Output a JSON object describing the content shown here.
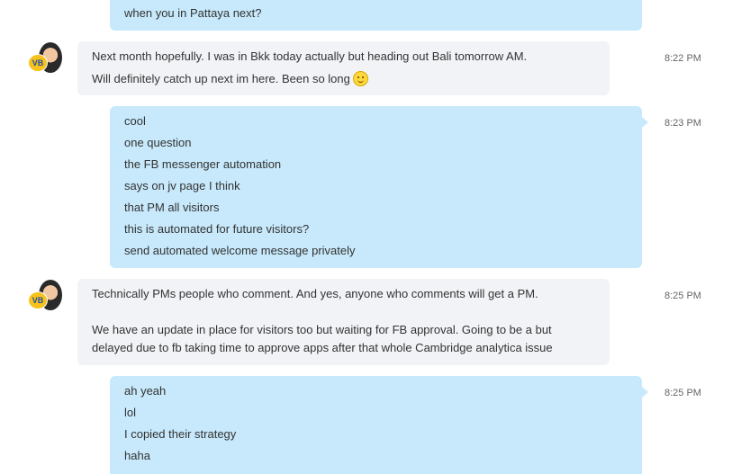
{
  "messages": [
    {
      "direction": "out",
      "lines": [
        "when you in Pattaya next?"
      ],
      "time": ""
    },
    {
      "direction": "in",
      "lines": [
        "Next month hopefully. I was in Bkk today actually but heading out Bali tomorrow AM.",
        "Will definitely catch up next im here. Been so long"
      ],
      "emoji": "wink-smile-icon",
      "time": "8:22 PM",
      "avatar_badge": "VB"
    },
    {
      "direction": "out",
      "lines": [
        "cool",
        "one question",
        "the FB messenger automation",
        "says on jv page I think",
        "that PM all visitors",
        "this is automated for future visitors?",
        "send automated welcome message privately"
      ],
      "time": "8:23 PM"
    },
    {
      "direction": "in",
      "lines": [
        "Technically PMs people who comment. And yes, anyone who comments will get a PM.",
        "",
        "We have an update in place for visitors too but waiting for FB approval. Going to be a but",
        "delayed due to fb taking time to approve apps after that whole Cambridge analytica issue"
      ],
      "time": "8:25 PM",
      "avatar_badge": "VB"
    },
    {
      "direction": "out",
      "lines": [
        "ah yeah",
        "lol",
        "I copied their strategy",
        "haha"
      ],
      "time": "8:25 PM"
    }
  ],
  "colors": {
    "outgoing_bubble": "#c7e9fb",
    "incoming_bubble": "#f1f3f6",
    "timestamp": "#666666"
  }
}
